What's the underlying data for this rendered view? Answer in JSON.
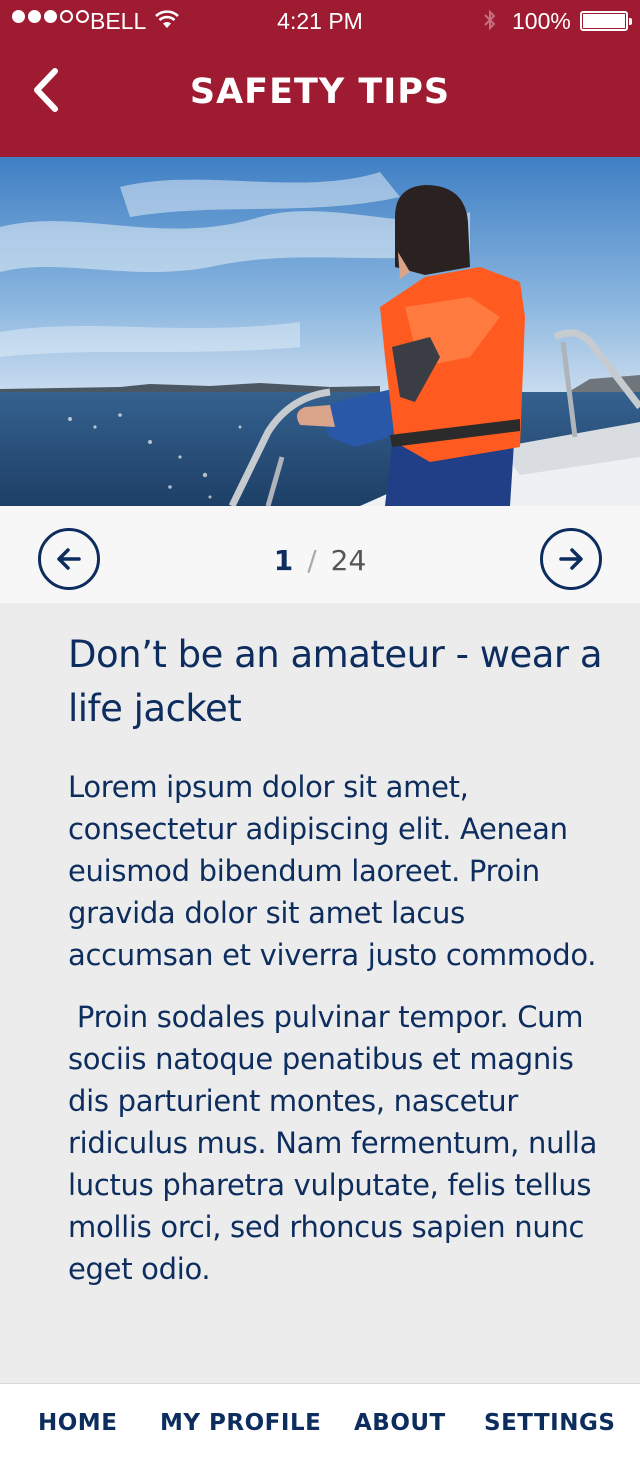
{
  "status_bar": {
    "carrier": "BELL",
    "time": "4:21 PM",
    "battery": "100%"
  },
  "header": {
    "title": "SAFETY TIPS"
  },
  "pager": {
    "current": "1",
    "separator": "/",
    "total": "24"
  },
  "article": {
    "title": "Don’t be an amateur - wear a life jacket",
    "paragraphs": [
      "Lorem ipsum dolor sit amet, consectetur adipiscing elit. Aenean euismod bibendum laoreet. Proin gravida dolor sit amet lacus accumsan et viverra justo commodo.",
      " Proin sodales pulvinar tempor. Cum sociis natoque penatibus et magnis dis parturient montes, nascetur ridiculus mus. Nam fermentum, nulla luctus pharetra vulputate, felis tellus mollis orci, sed rhoncus sapien nunc eget odio."
    ]
  },
  "tabbar": {
    "home": "HOME",
    "profile": "MY PROFILE",
    "about": "ABOUT",
    "settings": "SETTINGS"
  },
  "colors": {
    "brand_red": "#9e1b32",
    "navy": "#0d2d5e",
    "life_jacket": "#ff5a1f"
  },
  "icons": [
    "back-chevron-icon",
    "arrow-left-icon",
    "arrow-right-icon",
    "wifi-icon",
    "bluetooth-icon",
    "battery-icon"
  ]
}
